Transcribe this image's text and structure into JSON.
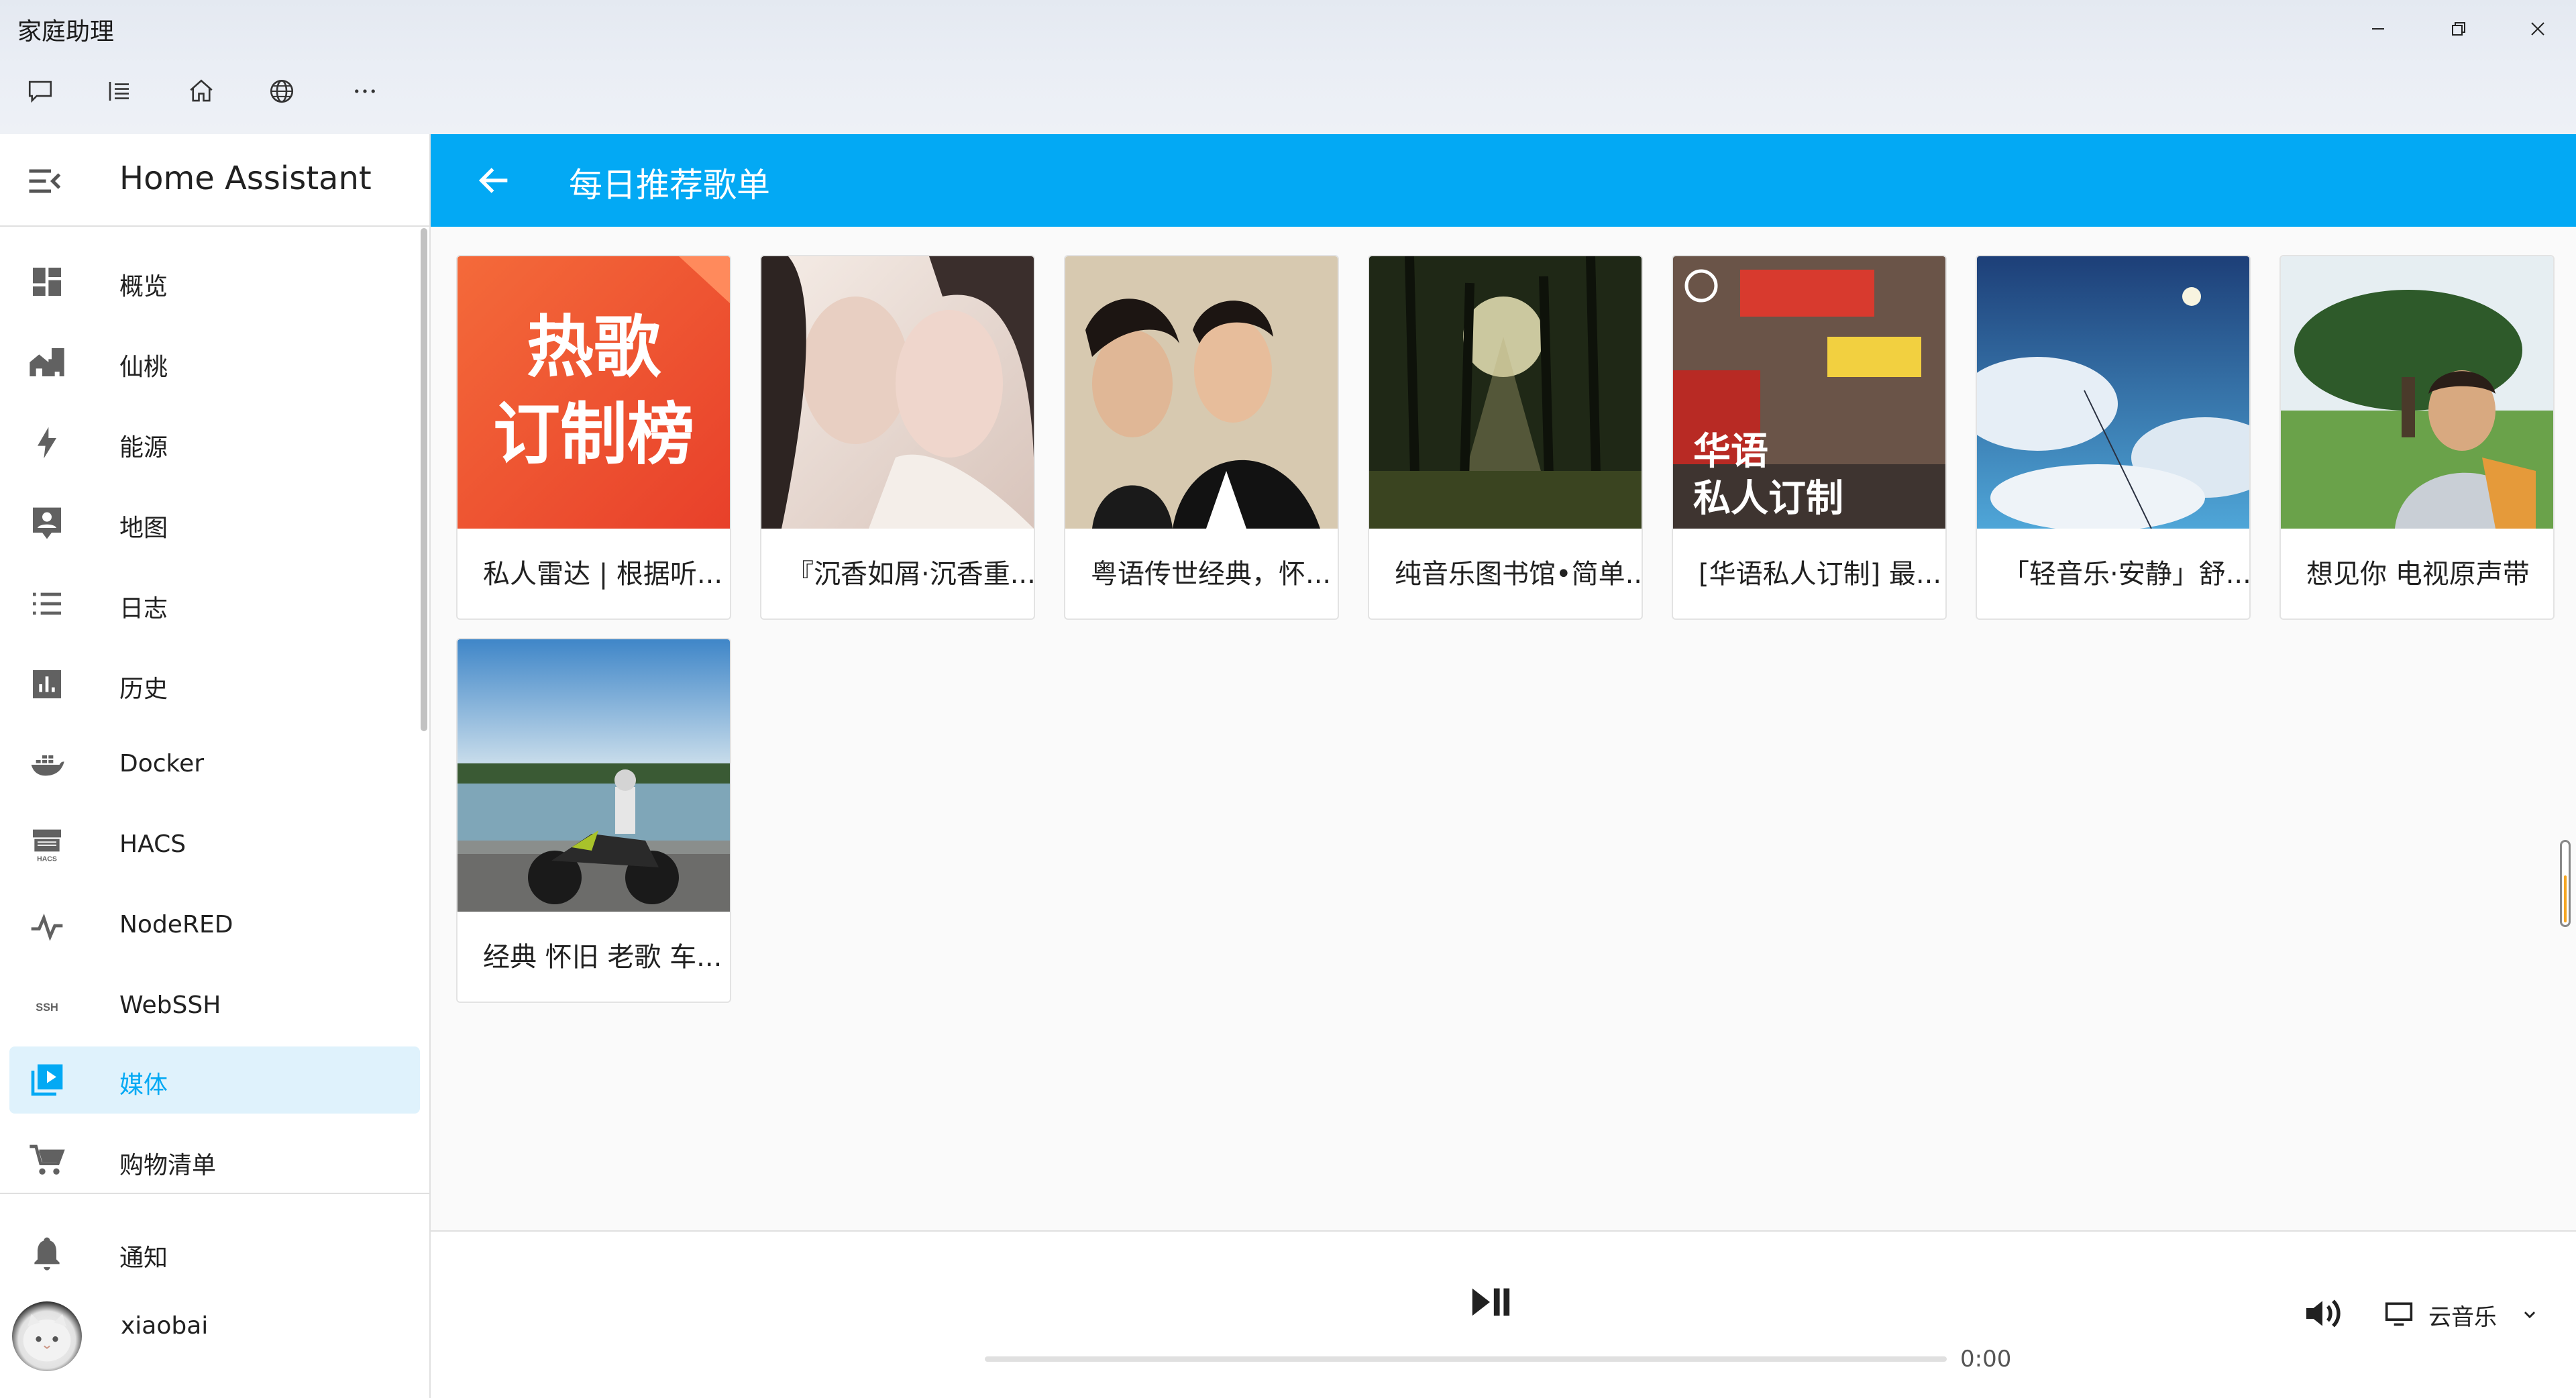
{
  "window": {
    "title": "家庭助理",
    "toolbar_icons": [
      "chat-icon",
      "list-icon",
      "home-icon",
      "globe-icon",
      "more-icon"
    ]
  },
  "sidebar": {
    "title": "Home Assistant",
    "items": [
      {
        "label": "概览",
        "icon": "dashboard-icon"
      },
      {
        "label": "仙桃",
        "icon": "home-city-icon"
      },
      {
        "label": "能源",
        "icon": "lightning-icon"
      },
      {
        "label": "地图",
        "icon": "map-person-icon"
      },
      {
        "label": "日志",
        "icon": "logbook-icon"
      },
      {
        "label": "历史",
        "icon": "history-chart-icon"
      },
      {
        "label": "Docker",
        "icon": "docker-icon"
      },
      {
        "label": "HACS",
        "icon": "hacs-icon"
      },
      {
        "label": "NodeRED",
        "icon": "nodered-icon"
      },
      {
        "label": "WebSSH",
        "icon": "ssh-icon"
      },
      {
        "label": "媒体",
        "icon": "media-icon",
        "active": true
      },
      {
        "label": "购物清单",
        "icon": "cart-icon"
      }
    ],
    "bottom": {
      "notifications_label": "通知",
      "user_name": "xiaobai"
    },
    "hacs_sub": "HACS",
    "ssh_text": "SSH"
  },
  "header": {
    "title": "每日推荐歌单"
  },
  "playlists": [
    {
      "caption": "私人雷达 | 根据听...",
      "cover_text": [
        "热歌",
        "订制榜"
      ]
    },
    {
      "caption": "『沉香如屑·沉香重..."
    },
    {
      "caption": "粤语传世经典，怀..."
    },
    {
      "caption": "纯音乐图书馆•简单..."
    },
    {
      "caption": "[华语私人订制] 最...",
      "cover_text": [
        "华语",
        "私人订制"
      ]
    },
    {
      "caption": "「轻音乐·安静」舒..."
    },
    {
      "caption": "想见你 电视原声带"
    },
    {
      "caption": "经典 怀旧 老歌 车..."
    }
  ],
  "player": {
    "time": "0:00",
    "source": "云音乐",
    "progress": 0
  },
  "colors": {
    "accent": "#03a9f4",
    "active_bg": "#dff2fc"
  }
}
